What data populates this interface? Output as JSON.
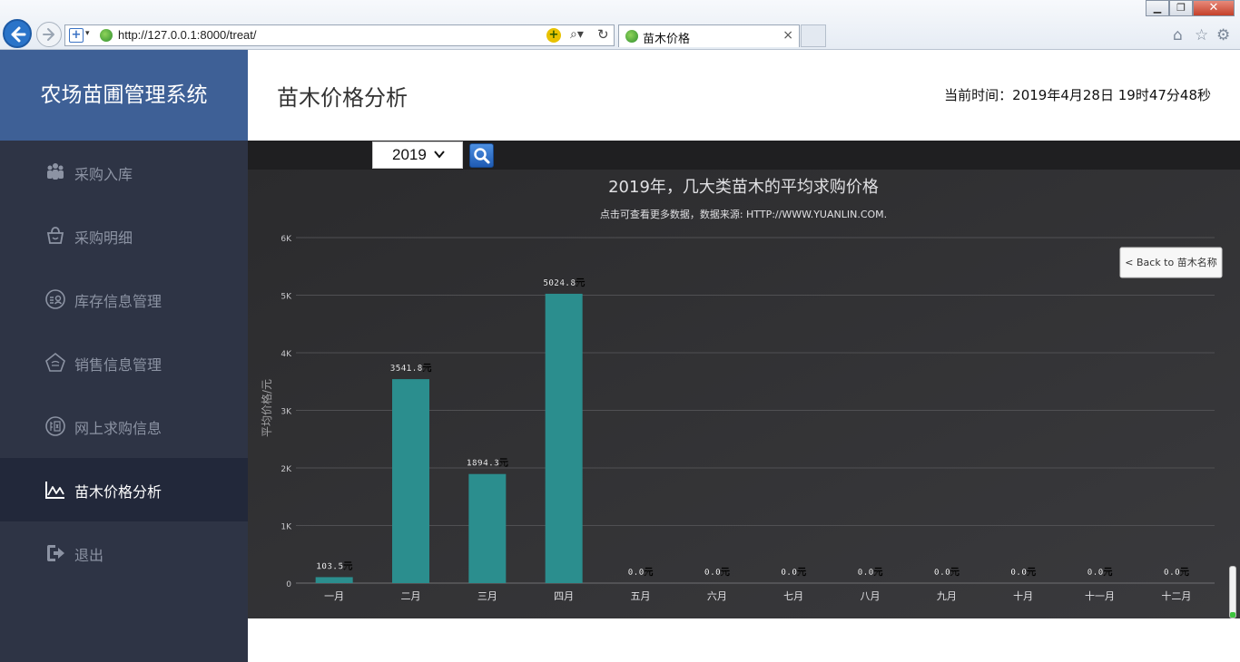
{
  "browser": {
    "url": "http://127.0.0.1:8000/treat/",
    "tab_title": "苗木价格",
    "tab_close": "×",
    "win_min": "▁",
    "win_max": "❐",
    "win_close": "✕"
  },
  "app": {
    "brand": "农场苗圃管理系统",
    "page_title": "苗木价格分析",
    "clock": "当前时间：2019年4月28日 19时47分48秒"
  },
  "sidebar": {
    "items": [
      {
        "label": "采购入库",
        "icon": "users-icon"
      },
      {
        "label": "采购明细",
        "icon": "basket-icon"
      },
      {
        "label": "库存信息管理",
        "icon": "inventory-icon"
      },
      {
        "label": "销售信息管理",
        "icon": "sales-icon"
      },
      {
        "label": "网上求购信息",
        "icon": "web-icon"
      },
      {
        "label": "苗木价格分析",
        "icon": "chart-icon",
        "active": true
      },
      {
        "label": "退出",
        "icon": "logout-icon"
      }
    ]
  },
  "filter": {
    "year": "2019"
  },
  "chart_data": {
    "type": "bar",
    "title": "2019年，几大类苗木的平均求购价格",
    "subtitle": "点击可查看更多数据，数据来源: HTTP://WWW.YUANLIN.COM.",
    "ylabel": "平均价格/元",
    "xlabel": "",
    "ylim": [
      0,
      6000
    ],
    "yticks": [
      "0",
      "1K",
      "2K",
      "3K",
      "4K",
      "5K",
      "6K"
    ],
    "categories": [
      "一月",
      "二月",
      "三月",
      "四月",
      "五月",
      "六月",
      "七月",
      "八月",
      "九月",
      "十月",
      "十一月",
      "十二月"
    ],
    "values": [
      103.5,
      3541.8,
      1894.3,
      5024.8,
      0,
      0,
      0,
      0,
      0,
      0,
      0,
      0
    ],
    "data_labels": [
      "103.5元",
      "3541.8元",
      "1894.3元",
      "5024.8元",
      "0.0元",
      "0.0元",
      "0.0元",
      "0.0元",
      "0.0元",
      "0.0元",
      "0.0元",
      "0.0元"
    ],
    "bar_color": "#2b8e8e",
    "grid": true,
    "back_button": "< Back to 苗木名称"
  }
}
